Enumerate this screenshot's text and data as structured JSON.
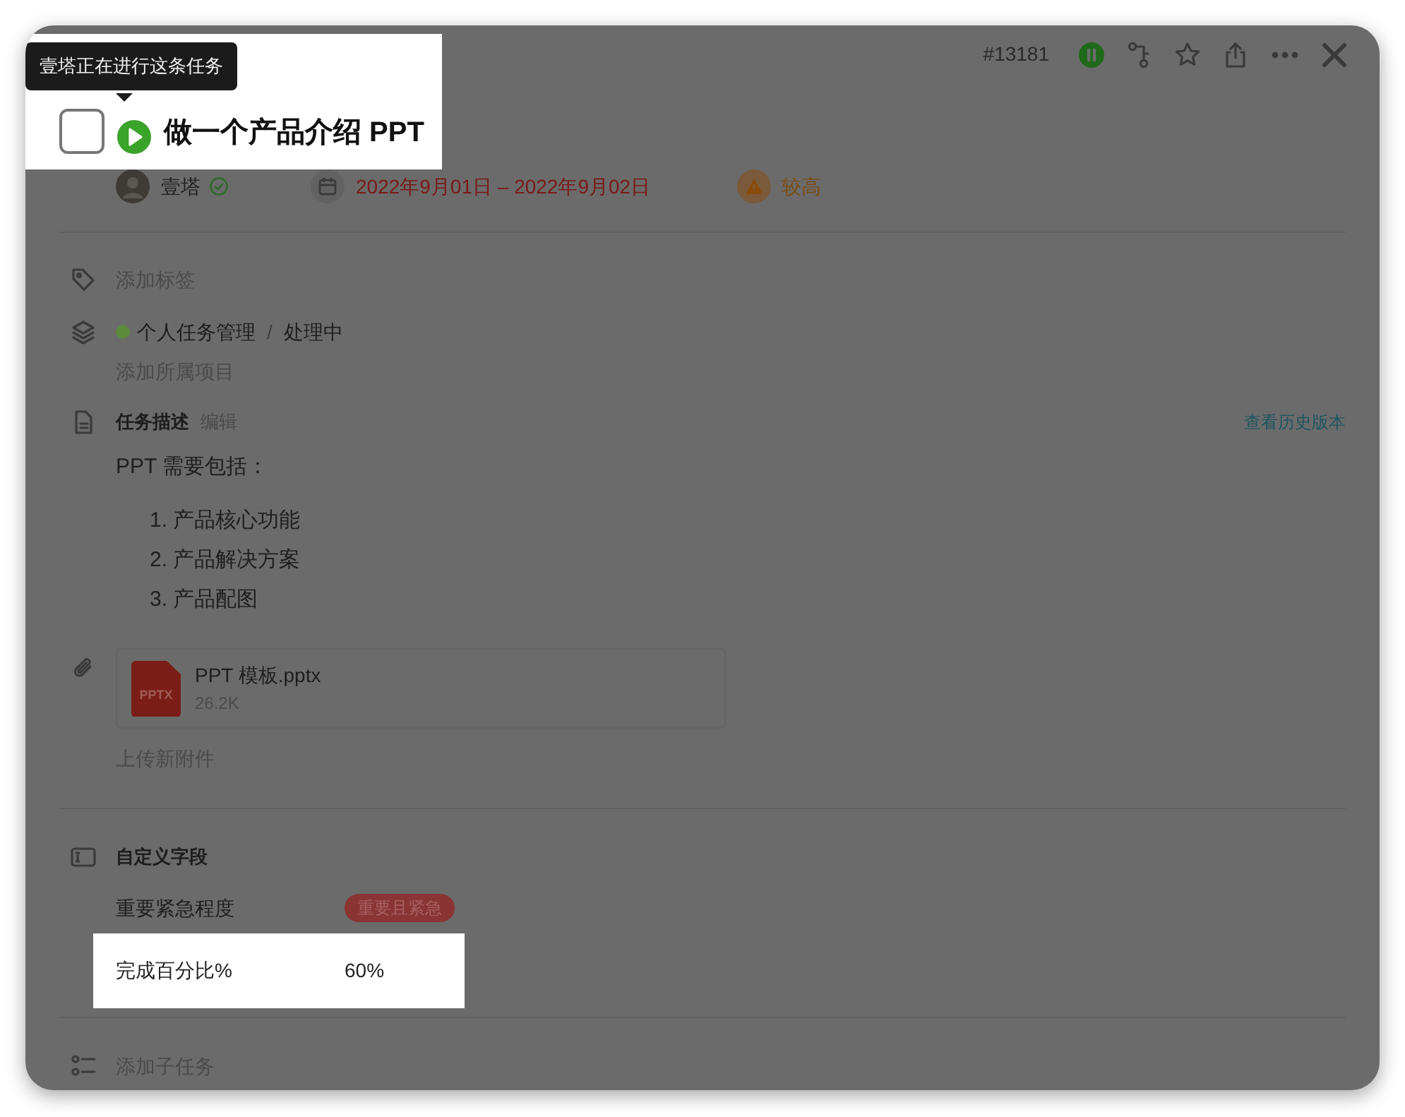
{
  "header": {
    "task_id": "#13181"
  },
  "tooltip": "壹塔正在进行这条任务",
  "task": {
    "title": "做一个产品介绍 PPT",
    "done": false,
    "highlighted": true
  },
  "meta": {
    "assignee": "壹塔",
    "date_range": "2022年9月01日 – 2022年9月02日",
    "priority": "较高"
  },
  "tags": {
    "add": "添加标签"
  },
  "project": {
    "name": "个人任务管理",
    "color": "#5e8a3c",
    "separator": "/",
    "status": "处理中",
    "add": "添加所属项目"
  },
  "description": {
    "title": "任务描述",
    "edit": "编辑",
    "history": "查看历史版本",
    "intro": "PPT 需要包括：",
    "items": [
      "1. 产品核心功能",
      "2. 产品解决方案",
      "3. 产品配图"
    ]
  },
  "attachment": {
    "badge": "PPTX",
    "name": "PPT 模板.pptx",
    "size": "26.2K"
  },
  "upload": "上传新附件",
  "custom_fields": {
    "title": "自定义字段",
    "fields": [
      {
        "label": "重要紧急程度",
        "value": "重要且紧急",
        "kind": "tag",
        "highlighted": false
      },
      {
        "label": "完成百分比%",
        "value": "60%",
        "kind": "text",
        "highlighted": true
      }
    ]
  },
  "subtasks": {
    "add": "添加子任务"
  }
}
